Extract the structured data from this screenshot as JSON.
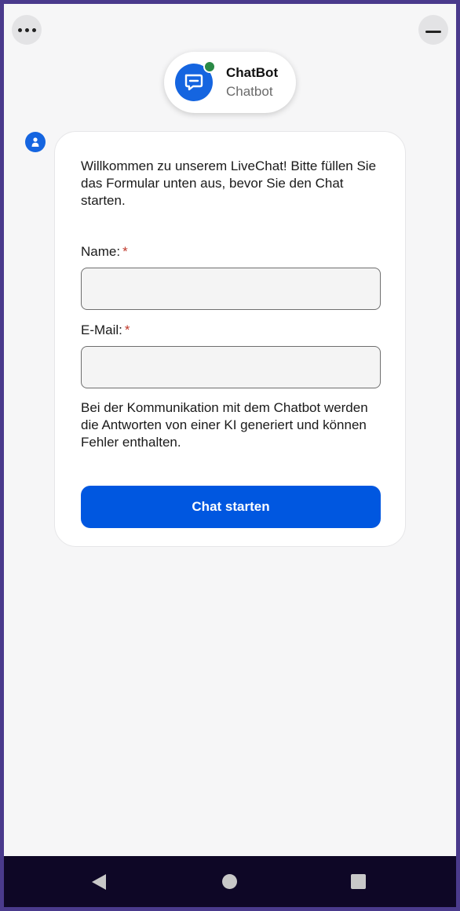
{
  "header": {
    "title": "ChatBot",
    "subtitle": "Chatbot",
    "bot_icon": "chat-bubble-icon",
    "status_color": "#2a8a46"
  },
  "toolbar": {
    "menu_icon": "more-dots-icon",
    "minimize_icon": "minimize-icon"
  },
  "form": {
    "intro": "Willkommen zu unserem LiveChat! Bitte füllen Sie das Formular unten aus, bevor Sie den Chat starten.",
    "name_label": "Name:",
    "name_required": "*",
    "name_value": "",
    "email_label": "E-Mail:",
    "email_required": "*",
    "email_value": "",
    "disclaimer": "Bei der Kommunikation mit dem Chatbot werden die Antworten von einer KI generiert und können Fehler enthalten.",
    "submit_label": "Chat starten"
  },
  "colors": {
    "accent": "#0057e0",
    "required": "#c0392b",
    "navbar": "#0e0726"
  },
  "navbar": {
    "back_icon": "back-triangle-icon",
    "home_icon": "home-circle-icon",
    "recent_icon": "recent-square-icon"
  }
}
